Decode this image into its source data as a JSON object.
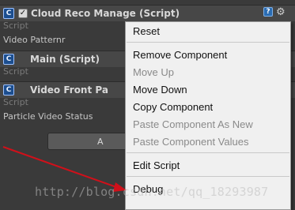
{
  "components": [
    {
      "title": "Cloud Reco Manage (Script)",
      "script_label": "Script",
      "field_label": "Video Patternr",
      "has_checkbox": true
    },
    {
      "title": "Main (Script)",
      "script_label": "Script",
      "field_label": ""
    },
    {
      "title": "Video Front Pa",
      "script_label": "Script",
      "field_label": "Particle Video Status"
    }
  ],
  "header_icons": {
    "help": "?",
    "gear": "⚙"
  },
  "add_component_button": {
    "label": "A"
  },
  "context_menu": {
    "items": [
      {
        "label": "Reset",
        "enabled": true
      },
      {
        "label": "Remove Component",
        "enabled": true
      },
      {
        "label": "Move Up",
        "enabled": false
      },
      {
        "label": "Move Down",
        "enabled": true
      },
      {
        "label": "Copy Component",
        "enabled": true
      },
      {
        "label": "Paste Component As New",
        "enabled": false
      },
      {
        "label": "Paste Component Values",
        "enabled": false
      },
      {
        "label": "Edit Script",
        "enabled": true
      },
      {
        "label": "Debug",
        "enabled": true
      }
    ]
  },
  "annotation": {
    "color": "#d0101a"
  },
  "watermark": "http://blog.csdn.net/qq_18293987"
}
